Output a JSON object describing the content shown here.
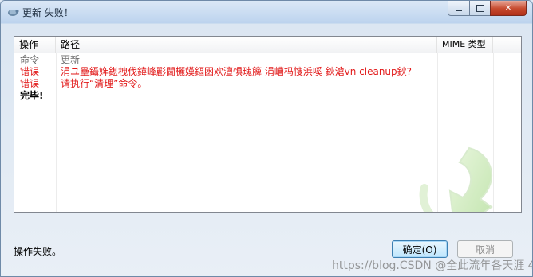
{
  "window": {
    "title": "更新 失败！",
    "icon": "tortoise-svn-icon"
  },
  "list": {
    "columns": [
      "操作",
      "路径",
      "MIME 类型",
      ""
    ],
    "rows": [
      {
        "op": "命令",
        "path": "更新",
        "color": "gray"
      },
      {
        "op": "错误",
        "path": "涓ユ壘鑷姩鍖栧伐鍏峰彲閫欐嫨鏂囦欢澶惧瑰簲   涓嶆杩愯浜嗘    鈥滄vn cleanup鈥?",
        "color": "red"
      },
      {
        "op": "错误",
        "path": "请执行“清理”命令。",
        "color": "red"
      },
      {
        "op": "完毕!",
        "path": "",
        "color": "black"
      }
    ]
  },
  "status": "操作失败。",
  "buttons": {
    "ok": "确定(O)",
    "cancel": "取消"
  },
  "watermark": "https://blog.CSDN @全此流年各天涯 4",
  "colors": {
    "error": "#e21b1b",
    "command": "#6d6d6d"
  }
}
